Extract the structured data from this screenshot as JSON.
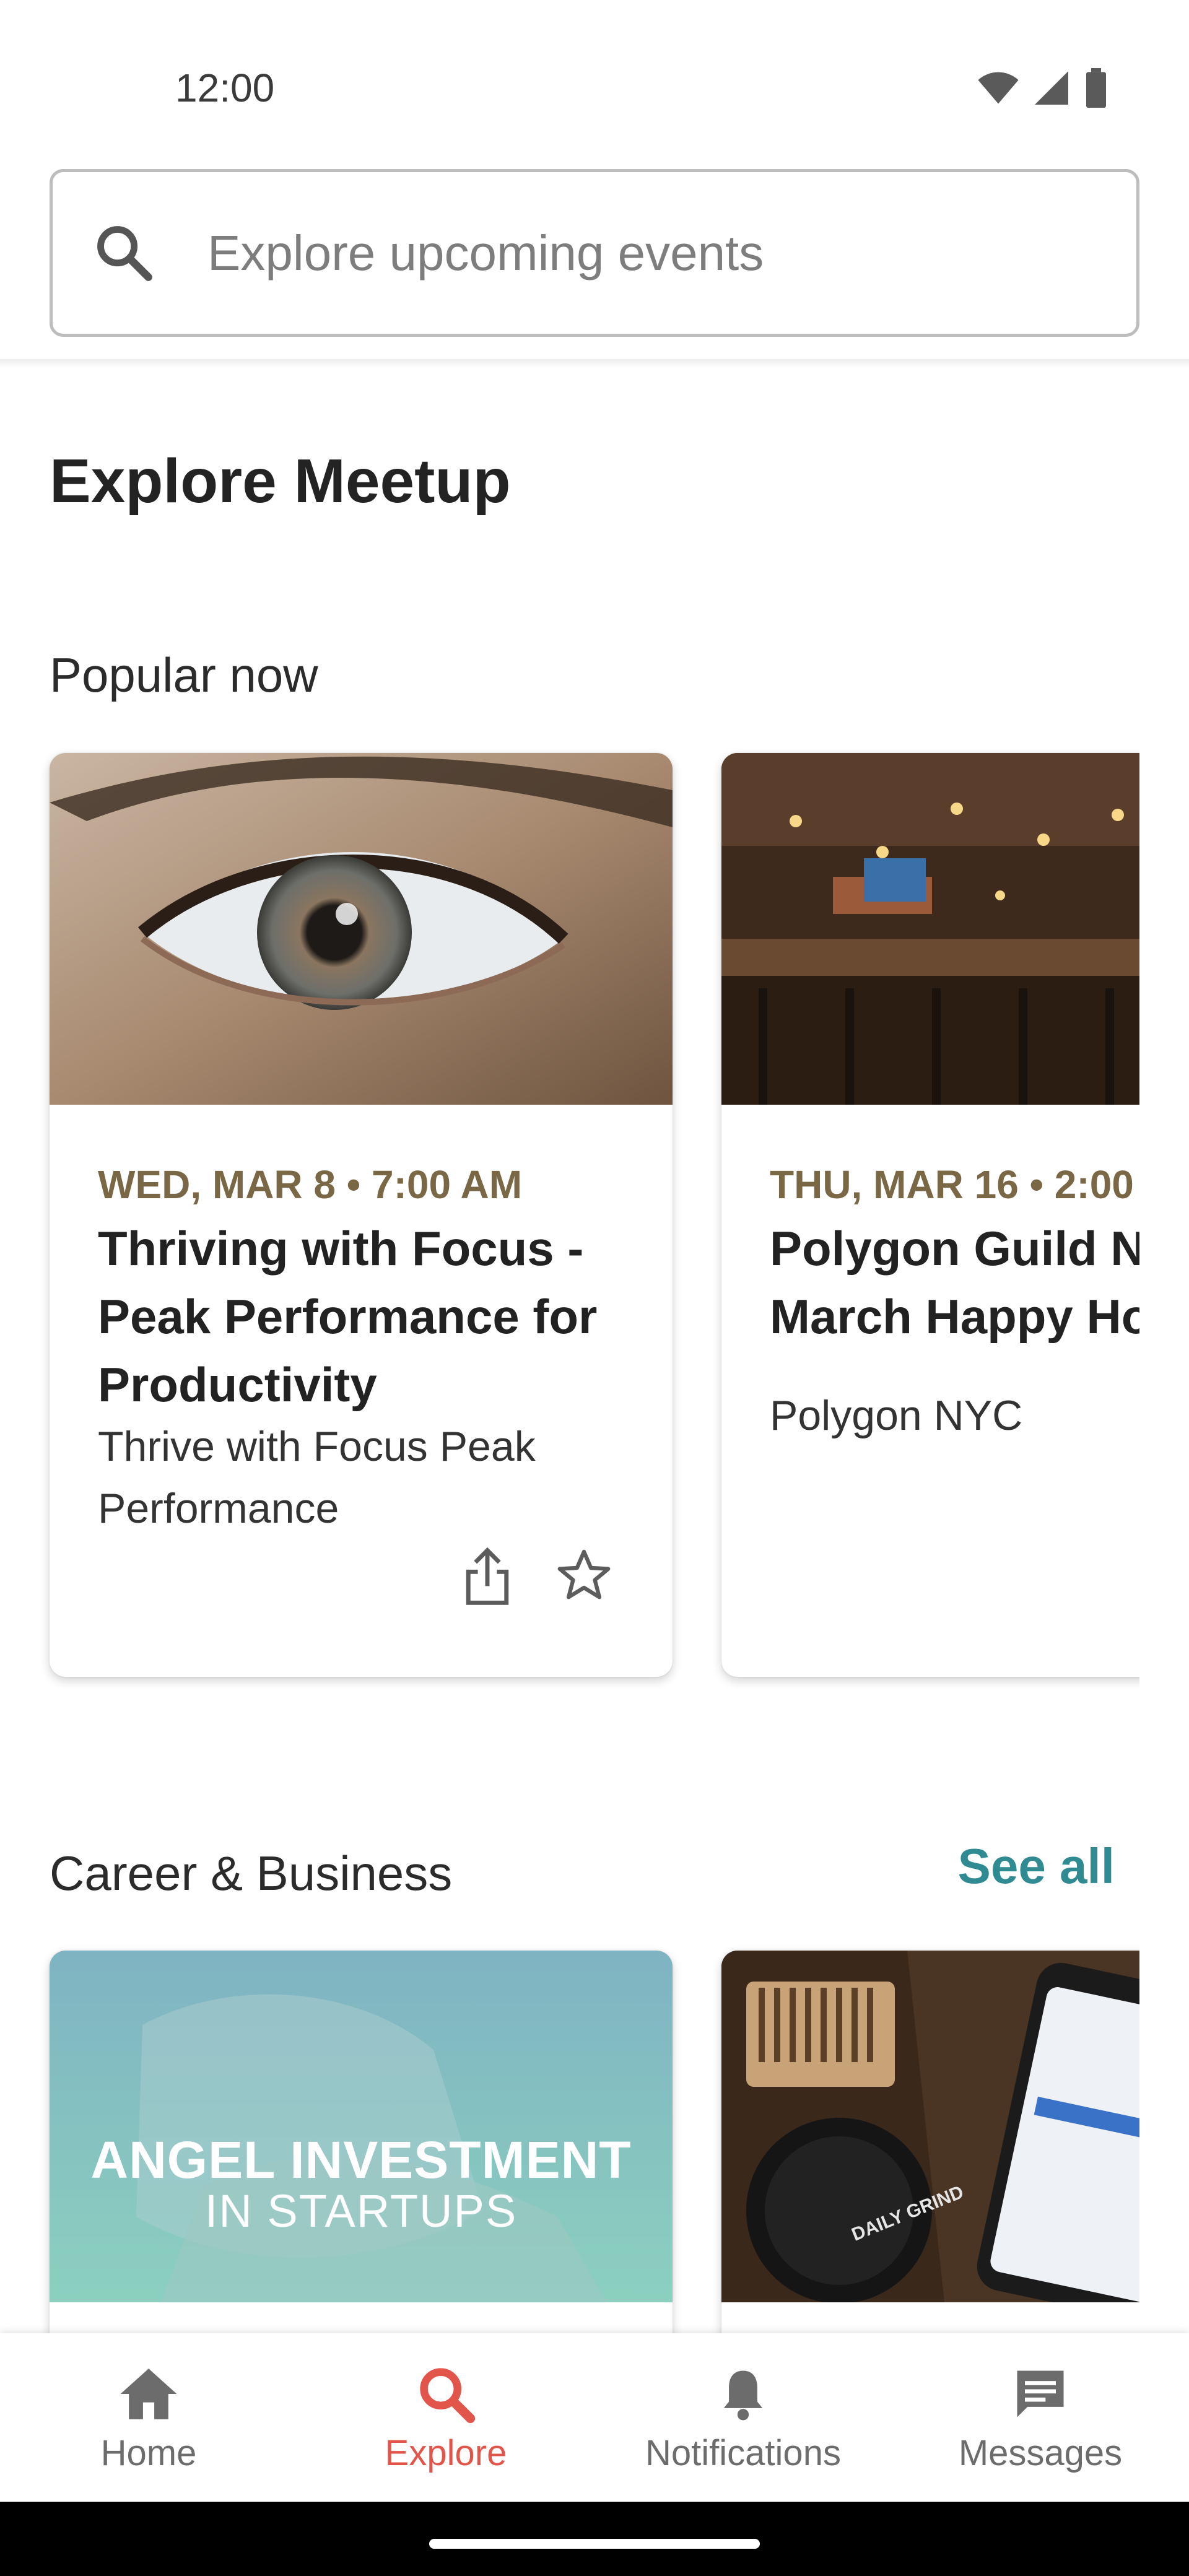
{
  "status_bar": {
    "time": "12:00"
  },
  "search": {
    "placeholder": "Explore upcoming events"
  },
  "page_title": "Explore Meetup",
  "popular": {
    "title": "Popular now",
    "cards": [
      {
        "date": "WED, MAR 8 • 7:00 AM",
        "title": "Thriving with Focus - Peak Performance for Productivity",
        "group": "Thrive with Focus Peak Performance"
      },
      {
        "date": "THU, MAR 16 • 2:00",
        "title": "Polygon Guild NYC March Happy Hour",
        "group": "Polygon NYC"
      }
    ]
  },
  "career": {
    "title": "Career & Business",
    "see_all": "See all",
    "cards": [
      {
        "image_line1": "ANGEL INVESTMENT",
        "image_line2": "IN STARTUPS"
      },
      {
        "image_text": "DAILY GRIND"
      }
    ]
  },
  "bottom_nav": {
    "items": [
      {
        "label": "Home",
        "icon": "home-icon"
      },
      {
        "label": "Explore",
        "icon": "search-icon",
        "active": true
      },
      {
        "label": "Notifications",
        "icon": "bell-icon"
      },
      {
        "label": "Messages",
        "icon": "message-icon"
      }
    ]
  },
  "colors": {
    "accent": "#e2554a",
    "link": "#2f8a92",
    "date": "#7a6746"
  }
}
